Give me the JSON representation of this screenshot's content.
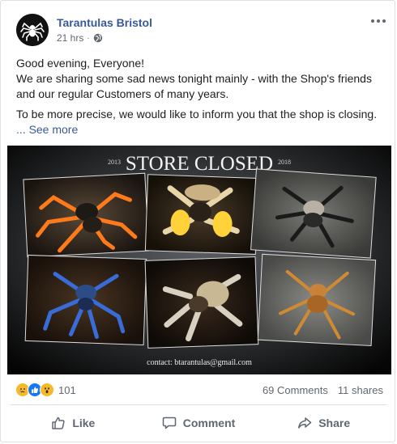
{
  "post": {
    "page_name": "Tarantulas Bristol",
    "time": "21 hrs",
    "privacy_icon": "globe-icon",
    "text_line1": "Good evening, Everyone!",
    "text_line2": "We are sharing some sad news tonight mainly - with the Shop's friends and our regular Customers of many years.",
    "text_line3": "To be more precise, we would like to inform you that the shop is closing.",
    "see_more_prefix": "...",
    "see_more": "See more"
  },
  "image": {
    "title": "STORE CLOSED",
    "year_left": "2013",
    "year_right": "2018",
    "contact": "contact: btarantulas@gmail.com"
  },
  "stats": {
    "reactions": [
      "sad",
      "like",
      "wow"
    ],
    "reaction_count": "101",
    "comments": "69 Comments",
    "shares": "11 shares"
  },
  "actions": {
    "like": "Like",
    "comment": "Comment",
    "share": "Share"
  },
  "colors": {
    "link_blue": "#385898",
    "like_blue": "#1877f2",
    "reaction_yellow": "#f7b928",
    "text_gray": "#606770"
  }
}
